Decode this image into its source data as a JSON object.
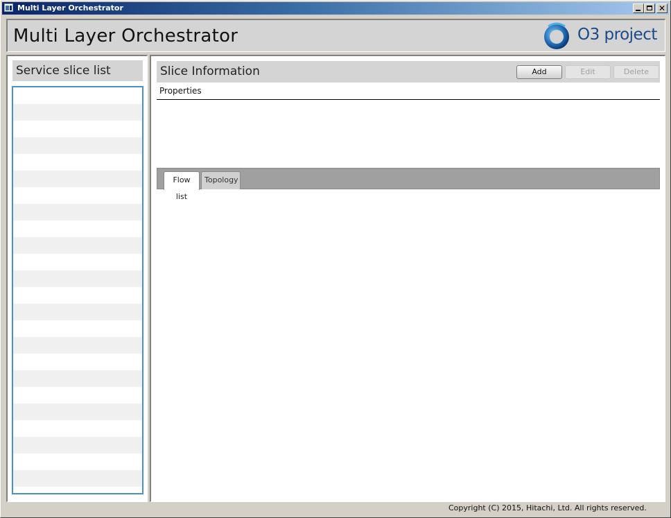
{
  "window": {
    "title": "Multi Layer Orchestrator",
    "controls": {
      "minimize": "_",
      "maximize": "□",
      "close": "✕"
    }
  },
  "header": {
    "app_title": "Multi Layer Orchestrator",
    "logo_text": "O3 project",
    "brand_color": "#1a4a8a"
  },
  "left_panel": {
    "heading": "Service slice list",
    "list_border_color": "#4a90c8",
    "rows": 24
  },
  "right_panel": {
    "heading": "Slice Information",
    "buttons": {
      "add": "Add",
      "edit": "Edit",
      "delete": "Delete"
    },
    "properties_label": "Properties",
    "tabs": [
      {
        "label": "Flow list",
        "active": true
      },
      {
        "label": "Topology",
        "active": false
      }
    ]
  },
  "footer": {
    "copyright": "Copyright (C) 2015, Hitachi, Ltd. All rights reserved."
  }
}
